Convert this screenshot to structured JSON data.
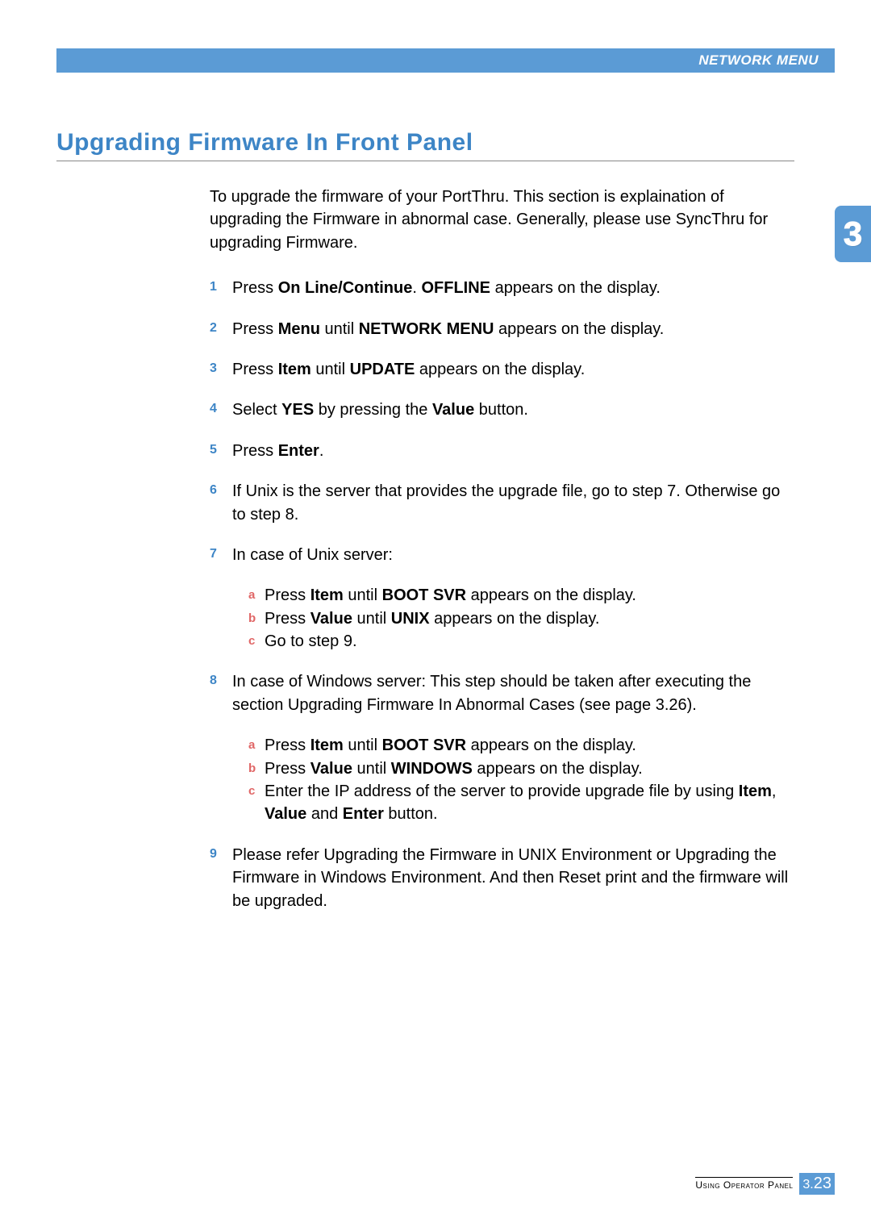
{
  "header": {
    "label": "NETWORK MENU"
  },
  "sideTab": {
    "number": "3"
  },
  "title": "Upgrading Firmware In Front Panel",
  "intro": "To upgrade the firmware of your PortThru. This section is explaination of upgrading the Firmware in abnormal case. Generally, please use SyncThru for upgrading Firmware.",
  "steps": {
    "s1": {
      "num": "1",
      "p1": "Press ",
      "b1": "On Line/Continue",
      "p2": ". ",
      "b2": "OFFLINE",
      "p3": " appears on the display."
    },
    "s2": {
      "num": "2",
      "p1": "Press ",
      "b1": "Menu",
      "p2": " until ",
      "b2": "NETWORK MENU",
      "p3": " appears on the display."
    },
    "s3": {
      "num": "3",
      "p1": "Press ",
      "b1": "Item",
      "p2": " until ",
      "b2": "UPDATE",
      "p3": " appears on the display."
    },
    "s4": {
      "num": "4",
      "p1": "Select ",
      "b1": "YES",
      "p2": " by pressing the ",
      "b2": "Value",
      "p3": " button."
    },
    "s5": {
      "num": "5",
      "p1": "Press ",
      "b1": "Enter",
      "p2": "."
    },
    "s6": {
      "num": "6",
      "p1": "If Unix is the server that provides the upgrade file, go to step 7. Otherwise go to step 8."
    },
    "s7": {
      "num": "7",
      "intro": "In case of Unix server:",
      "a": {
        "l": "a",
        "p1": "Press ",
        "b1": "Item",
        "p2": " until ",
        "b2": "BOOT SVR",
        "p3": " appears on the display."
      },
      "b": {
        "l": "b",
        "p1": "Press ",
        "b1": "Value",
        "p2": " until ",
        "b2": "UNIX",
        "p3": " appears on the display."
      },
      "c": {
        "l": "c",
        "p1": "Go to step 9."
      }
    },
    "s8": {
      "num": "8",
      "intro": "In case of Windows server: This step should be taken after executing the section Upgrading Firmware In Abnormal Cases (see page 3.26).",
      "a": {
        "l": "a",
        "p1": "Press ",
        "b1": "Item",
        "p2": " until ",
        "b2": "BOOT SVR",
        "p3": " appears on the display."
      },
      "b": {
        "l": "b",
        "p1": "Press ",
        "b1": "Value",
        "p2": " until ",
        "b2": "WINDOWS",
        "p3": " appears on the display."
      },
      "c": {
        "l": "c",
        "p1": "Enter the IP address of the server to provide upgrade file by using ",
        "b1": "Item",
        "p2": ", ",
        "b2": "Value",
        "p3": " and ",
        "b3": "Enter",
        "p4": " button."
      }
    },
    "s9": {
      "num": "9",
      "p1": "Please refer Upgrading the Firmware in UNIX Environment or Upgrading the Firmware in Windows Environment. And then Reset print and the firmware will be upgraded."
    }
  },
  "footer": {
    "label": "Using Operator Panel",
    "chapter": "3.",
    "page": "23"
  }
}
